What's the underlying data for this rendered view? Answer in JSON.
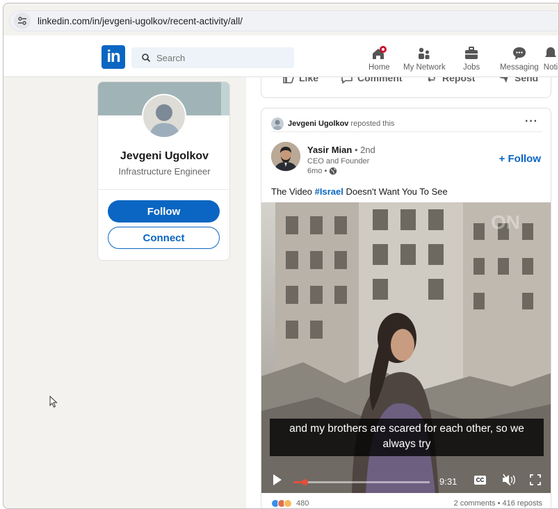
{
  "browser": {
    "url": "linkedin.com/in/jevgeni-ugolkov/recent-activity/all/"
  },
  "nav": {
    "logo": "in",
    "search_placeholder": "Search",
    "items": [
      {
        "label": "Home",
        "icon": "home-icon"
      },
      {
        "label": "My Network",
        "icon": "network-icon"
      },
      {
        "label": "Jobs",
        "icon": "briefcase-icon"
      },
      {
        "label": "Messaging",
        "icon": "messaging-icon"
      },
      {
        "label": "Noti",
        "icon": "bell-icon"
      }
    ],
    "accent_color": "#0a66c2",
    "notification_color": "#cb112d"
  },
  "profile": {
    "name": "Jevgeni Ugolkov",
    "title": "Infrastructure Engineer",
    "follow_label": "Follow",
    "connect_label": "Connect"
  },
  "previous_post_actions": [
    {
      "label": "Like",
      "icon": "like-icon"
    },
    {
      "label": "Comment",
      "icon": "comment-icon"
    },
    {
      "label": "Repost",
      "icon": "repost-icon"
    },
    {
      "label": "Send",
      "icon": "send-icon"
    }
  ],
  "post": {
    "repost_by": "Jevgeni Ugolkov",
    "repost_text": "reposted this",
    "more_label": "···",
    "author": {
      "name": "Yasir Mian",
      "degree": "• 2nd",
      "title": "CEO and Founder",
      "time": "6mo •"
    },
    "follow_label": "+ Follow",
    "text_before": "The Video ",
    "hashtag": "#Israel",
    "text_after": " Doesn't Want You To See",
    "video": {
      "caption": "and my brothers are scared for each other, so we always try",
      "time": "9:31",
      "cc_label": "CC",
      "progress": 0.08
    },
    "reaction_count": "480",
    "comments_reposts": "2 comments • 416 reposts"
  }
}
